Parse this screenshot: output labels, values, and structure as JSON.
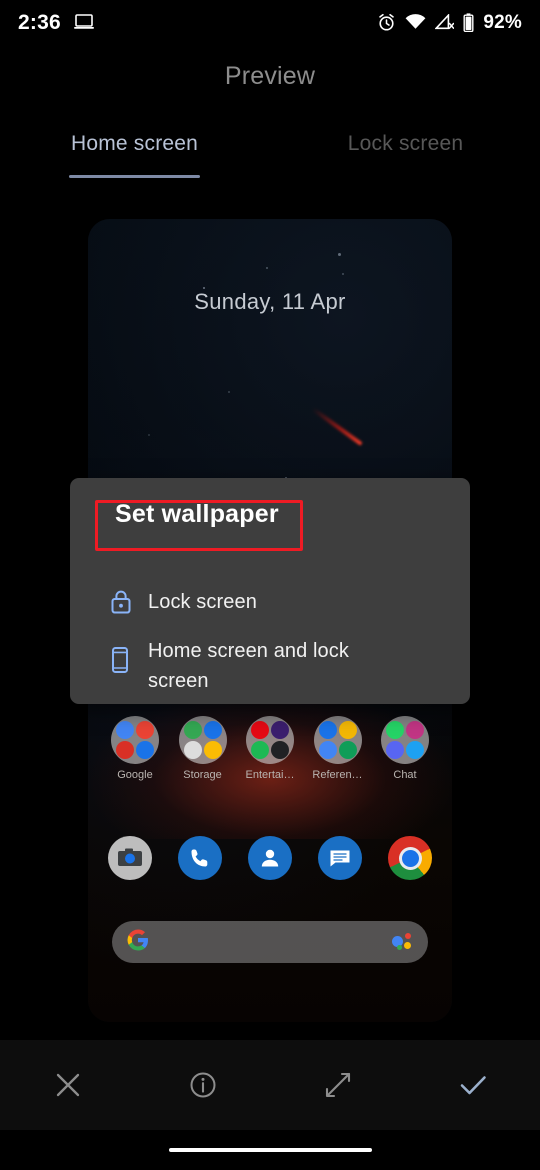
{
  "status_bar": {
    "time": "2:36",
    "battery_percent": "92%",
    "icons": [
      "laptop-icon",
      "alarm-icon",
      "wifi-icon",
      "signal-off-icon",
      "battery-icon"
    ]
  },
  "header": {
    "title": "Preview"
  },
  "tabs": [
    {
      "label": "Home screen",
      "selected": true
    },
    {
      "label": "Lock screen",
      "selected": false
    }
  ],
  "wallpaper_preview": {
    "date_text": "Sunday, 11 Apr",
    "folders": [
      {
        "label": "Google",
        "colors": [
          "#4285f4",
          "#ea4335",
          "#d93025",
          "#1a73e8"
        ]
      },
      {
        "label": "Storage",
        "colors": [
          "#34a853",
          "#1a73e8",
          "#ffffff",
          "#fbbc04"
        ]
      },
      {
        "label": "Entertai…",
        "colors": [
          "#e50914",
          "#3b1e6e",
          "#1db954",
          "#202124"
        ]
      },
      {
        "label": "Referen…",
        "colors": [
          "#1a73e8",
          "#f2b705",
          "#4285f4",
          "#0f9d58"
        ]
      },
      {
        "label": "Chat",
        "colors": [
          "#25d366",
          "#c13584",
          "#5865f2",
          "#1da1f2"
        ]
      }
    ],
    "dock": [
      {
        "name": "camera-icon",
        "style": "camera"
      },
      {
        "name": "phone-icon",
        "style": "blue"
      },
      {
        "name": "contacts-icon",
        "style": "blue"
      },
      {
        "name": "messages-icon",
        "style": "blue"
      },
      {
        "name": "chrome-icon",
        "style": "chrome"
      }
    ],
    "search_bar": {
      "google_logo": "G",
      "assistant_icon": "google-assistant-icon"
    }
  },
  "dialog": {
    "title": "Set wallpaper",
    "title_highlight_color": "#ee1b24",
    "accent_color": "#8ab4f8",
    "options": [
      {
        "icon": "lock-icon",
        "label": "Lock screen"
      },
      {
        "icon": "phone-icon",
        "label": "Home screen and lock screen"
      }
    ]
  },
  "action_bar": {
    "buttons": [
      {
        "name": "close-icon",
        "label": "Close"
      },
      {
        "name": "info-icon",
        "label": "Info"
      },
      {
        "name": "expand-icon",
        "label": "Expand"
      },
      {
        "name": "check-icon",
        "label": "Apply"
      }
    ]
  }
}
